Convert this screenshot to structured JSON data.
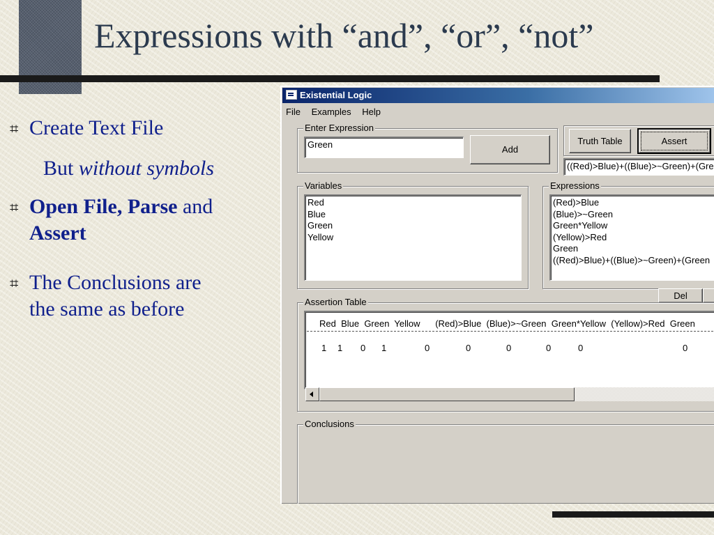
{
  "slide": {
    "title": "Expressions with “and”, “or”, “not”",
    "bullet_glyph": "⌗",
    "bullets": [
      {
        "text": "Create Text File"
      },
      {
        "sub_plain": "But ",
        "sub_italic": "without symbols"
      },
      {
        "bold": "Open File, Parse",
        "plain": " and",
        "bold2": "Assert"
      },
      {
        "line1": "The Conclusions are",
        "line2": "the same as before"
      }
    ]
  },
  "window": {
    "title": "Existential Logic",
    "menu": [
      "File",
      "Examples",
      "Help"
    ],
    "enter_expression": {
      "label": "Enter Expression",
      "value": "Green",
      "add_label": "Add"
    },
    "buttons": {
      "truth_table": "Truth Table",
      "assert": "Assert",
      "del": "Del"
    },
    "combined_expression": "((Red)>Blue)+((Blue)>~Green)+(Green",
    "variables": {
      "label": "Variables",
      "items": [
        "Red",
        "Blue",
        "Green",
        "Yellow"
      ]
    },
    "expressions": {
      "label": "Expressions",
      "items": [
        "(Red)>Blue",
        "(Blue)>~Green",
        "Green*Yellow",
        "(Yellow)>Red",
        "Green",
        "((Red)>Blue)+((Blue)>~Green)+(Green"
      ]
    },
    "assertion_table": {
      "label": "Assertion Table",
      "header": "Red  Blue  Green  Yellow      (Red)>Blue  (Blue)>~Green  Green*Yellow  (Yellow)>Red  Green",
      "row": [
        "1",
        "1",
        "0",
        "1",
        "0",
        "0",
        "0",
        "0",
        "0",
        "0"
      ]
    },
    "conclusions": {
      "label": "Conclusions"
    }
  }
}
